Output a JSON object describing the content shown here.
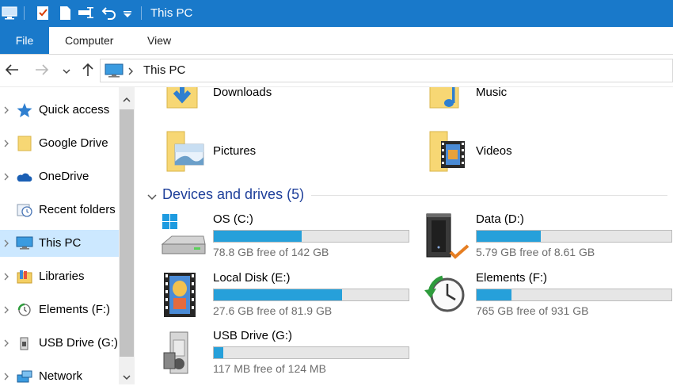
{
  "window": {
    "title": "This PC"
  },
  "quick_access": {
    "icons": [
      "computer-icon",
      "properties-icon",
      "new-folder-icon",
      "rename-icon",
      "undo-icon",
      "customize-dropdown-icon"
    ]
  },
  "ribbon": {
    "tabs": [
      {
        "label": "File",
        "active": true
      },
      {
        "label": "Computer"
      },
      {
        "label": "View"
      }
    ]
  },
  "address": {
    "path": "This PC",
    "icon": "computer-icon"
  },
  "nav": {
    "items": [
      {
        "label": "Quick access",
        "icon": "star-icon"
      },
      {
        "label": "Google Drive",
        "icon": "folder-icon"
      },
      {
        "label": "OneDrive",
        "icon": "cloud-icon"
      },
      {
        "label": "Recent folders",
        "icon": "recent-folders-icon"
      },
      {
        "label": "This PC",
        "icon": "computer-icon",
        "selected": true
      },
      {
        "label": "Libraries",
        "icon": "libraries-icon"
      },
      {
        "label": "Elements (F:)",
        "icon": "drive-icon"
      },
      {
        "label": "USB Drive (G:)",
        "icon": "usb-icon"
      },
      {
        "label": "Network",
        "icon": "network-icon"
      }
    ]
  },
  "folders": [
    {
      "label": "Downloads",
      "icon": "downloads-folder-icon"
    },
    {
      "label": "Music",
      "icon": "music-folder-icon"
    },
    {
      "label": "Pictures",
      "icon": "pictures-folder-icon"
    },
    {
      "label": "Videos",
      "icon": "videos-folder-icon"
    }
  ],
  "devices_group": {
    "title": "Devices and drives (5)"
  },
  "drives": [
    {
      "name": "OS (C:)",
      "free_text": "78.8 GB free of 142 GB",
      "used_fraction": 0.45,
      "icon": "windows-drive-icon"
    },
    {
      "name": "Data (D:)",
      "free_text": "5.79 GB free of 8.61 GB",
      "used_fraction": 0.33,
      "icon": "server-drive-icon"
    },
    {
      "name": "Local Disk (E:)",
      "free_text": "27.6 GB free of 81.9 GB",
      "used_fraction": 0.66,
      "icon": "film-drive-icon"
    },
    {
      "name": "Elements (F:)",
      "free_text": "765 GB free of 931 GB",
      "used_fraction": 0.18,
      "icon": "backup-clock-icon"
    },
    {
      "name": "USB Drive (G:)",
      "free_text": "117 MB free of 124 MB",
      "used_fraction": 0.05,
      "icon": "usb-drive-icon"
    }
  ],
  "colors": {
    "accent": "#1979ca",
    "bar_fill": "#26a0da",
    "selected_bg": "#cce8ff",
    "group_title": "#1e3f9a"
  }
}
